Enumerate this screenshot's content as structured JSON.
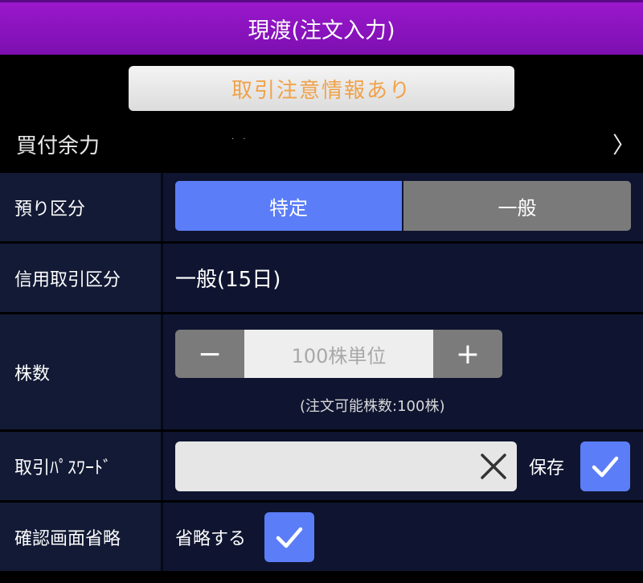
{
  "header": {
    "title": "現渡(注文入力)"
  },
  "caution_button": {
    "label": "取引注意情報あり"
  },
  "buying_power": {
    "label": "買付余力",
    "value": "· ·",
    "chevron": "〉"
  },
  "deposit_type": {
    "label": "預り区分",
    "options": [
      "特定",
      "一般"
    ],
    "selected": "特定"
  },
  "margin_type": {
    "label": "信用取引区分",
    "value": "一般(15日)"
  },
  "shares": {
    "label": "株数",
    "minus": "−",
    "plus": "+",
    "placeholder": "100株単位",
    "available": "(注文可能株数:100株)"
  },
  "password": {
    "label": "取引ﾊﾟｽﾜｰﾄﾞ",
    "value": "",
    "save_label": "保存",
    "save_checked": true
  },
  "confirm_skip": {
    "label": "確認画面省略",
    "option_label": "省略する",
    "checked": true
  },
  "colors": {
    "header": "#8a14bf",
    "accent": "#5b7df7",
    "caution_text": "#f0a24a",
    "label_bg": "#121a35"
  }
}
